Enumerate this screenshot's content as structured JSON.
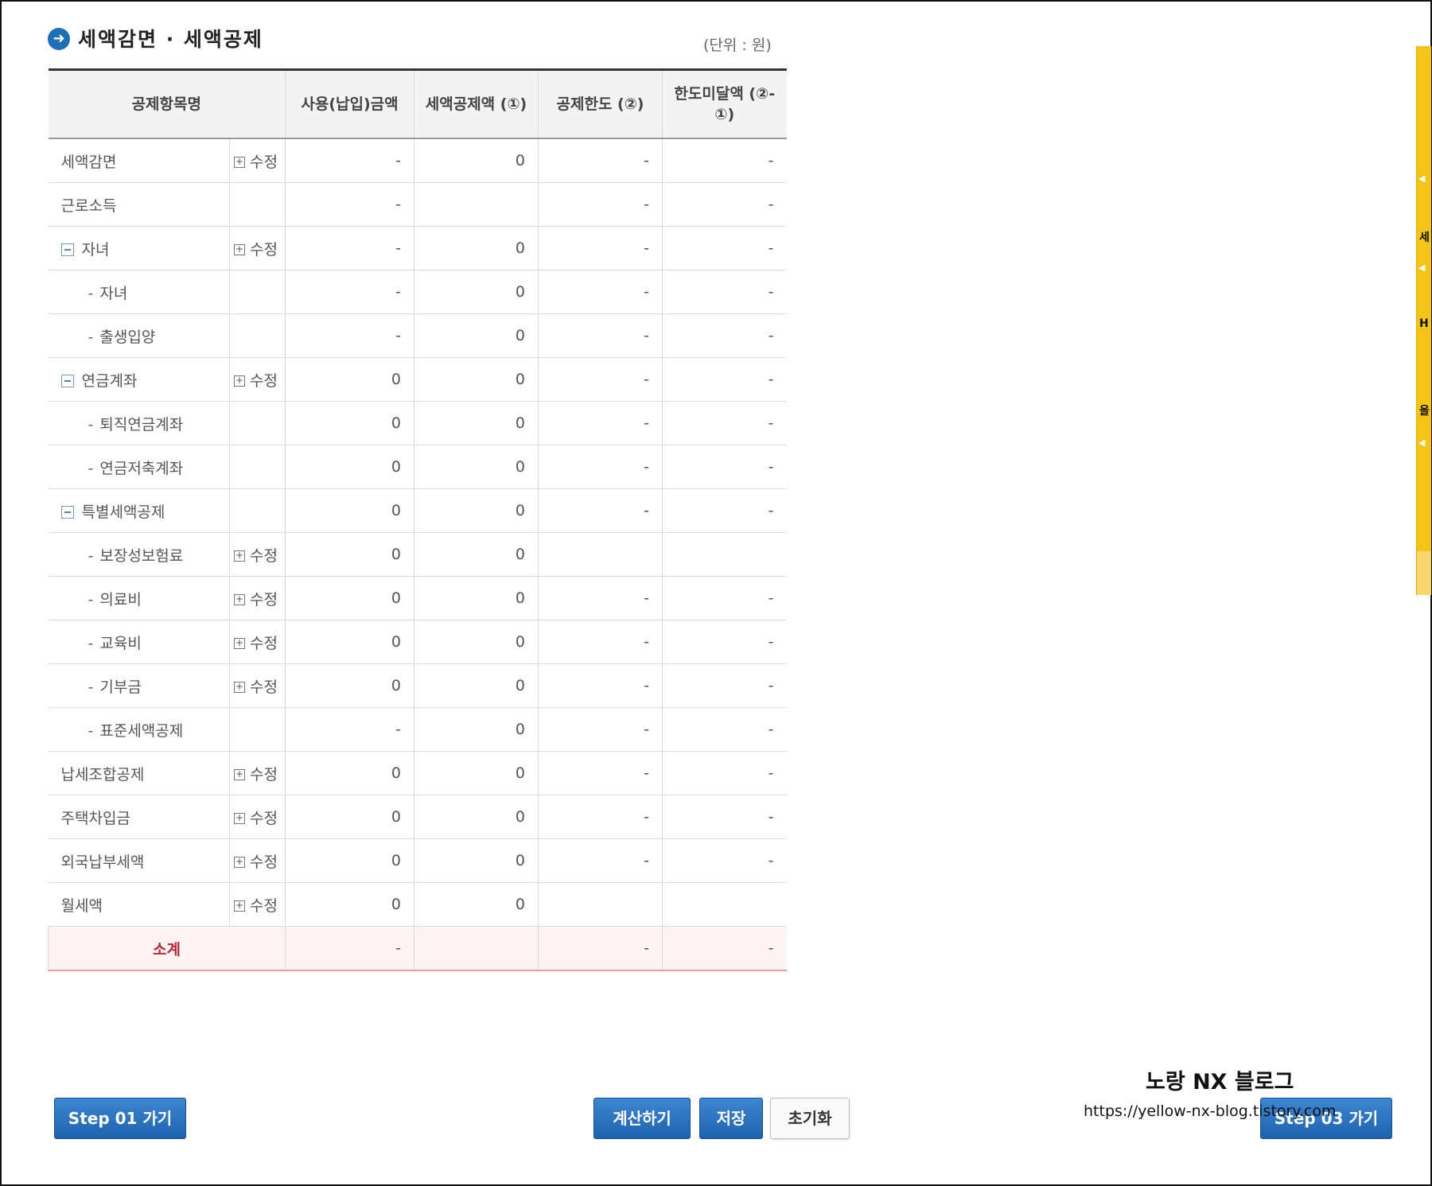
{
  "section": {
    "icon": "arrow-right-circle-icon",
    "title": "세액감면 · 세액공제",
    "unit": "(단위 : 원)"
  },
  "table": {
    "headers": {
      "item": "공제항목명",
      "used": "사용(납입)금액",
      "credit": "세액공제액 (①)",
      "limit": "공제한도 (②)",
      "remaining": "한도미달액 (②-①)"
    },
    "edit_label": "수정",
    "rows": [
      {
        "name": "세액감면",
        "level": 0,
        "collapsible": false,
        "edit": true,
        "used": "-",
        "credit": "0",
        "limit": "-",
        "remaining": "-"
      },
      {
        "name": "근로소득",
        "level": 0,
        "collapsible": false,
        "edit": false,
        "used": "-",
        "credit": "",
        "limit": "-",
        "remaining": "-"
      },
      {
        "name": "자녀",
        "level": 0,
        "collapsible": true,
        "edit": true,
        "used": "-",
        "credit": "0",
        "limit": "-",
        "remaining": "-"
      },
      {
        "name": "자녀",
        "level": 1,
        "collapsible": false,
        "edit": false,
        "used": "-",
        "credit": "0",
        "limit": "-",
        "remaining": "-"
      },
      {
        "name": "출생입양",
        "level": 1,
        "collapsible": false,
        "edit": false,
        "used": "-",
        "credit": "0",
        "limit": "-",
        "remaining": "-"
      },
      {
        "name": "연금계좌",
        "level": 0,
        "collapsible": true,
        "edit": true,
        "used": "0",
        "credit": "0",
        "limit": "-",
        "remaining": "-"
      },
      {
        "name": "퇴직연금계좌",
        "level": 1,
        "collapsible": false,
        "edit": false,
        "used": "0",
        "credit": "0",
        "limit": "-",
        "remaining": "-"
      },
      {
        "name": "연금저축계좌",
        "level": 1,
        "collapsible": false,
        "edit": false,
        "used": "0",
        "credit": "0",
        "limit": "-",
        "remaining": "-"
      },
      {
        "name": "특별세액공제",
        "level": 0,
        "collapsible": true,
        "edit": false,
        "used": "0",
        "credit": "0",
        "limit": "-",
        "remaining": "-"
      },
      {
        "name": "보장성보험료",
        "level": 1,
        "collapsible": false,
        "edit": true,
        "used": "0",
        "credit": "0",
        "limit": "",
        "remaining": ""
      },
      {
        "name": "의료비",
        "level": 1,
        "collapsible": false,
        "edit": true,
        "used": "0",
        "credit": "0",
        "limit": "-",
        "remaining": "-"
      },
      {
        "name": "교육비",
        "level": 1,
        "collapsible": false,
        "edit": true,
        "used": "0",
        "credit": "0",
        "limit": "-",
        "remaining": "-"
      },
      {
        "name": "기부금",
        "level": 1,
        "collapsible": false,
        "edit": true,
        "used": "0",
        "credit": "0",
        "limit": "-",
        "remaining": "-"
      },
      {
        "name": "표준세액공제",
        "level": 1,
        "collapsible": false,
        "edit": false,
        "used": "-",
        "credit": "0",
        "limit": "-",
        "remaining": "-"
      },
      {
        "name": "납세조합공제",
        "level": 0,
        "collapsible": false,
        "edit": true,
        "used": "0",
        "credit": "0",
        "limit": "-",
        "remaining": "-"
      },
      {
        "name": "주택차입금",
        "level": 0,
        "collapsible": false,
        "edit": true,
        "used": "0",
        "credit": "0",
        "limit": "-",
        "remaining": "-"
      },
      {
        "name": "외국납부세액",
        "level": 0,
        "collapsible": false,
        "edit": true,
        "used": "0",
        "credit": "0",
        "limit": "-",
        "remaining": "-"
      },
      {
        "name": "월세액",
        "level": 0,
        "collapsible": false,
        "edit": true,
        "used": "0",
        "credit": "0",
        "limit": "",
        "remaining": ""
      }
    ],
    "total": {
      "label": "소계",
      "used": "-",
      "credit": "",
      "limit": "-",
      "remaining": "-"
    }
  },
  "buttons": {
    "prev": "Step 01 가기",
    "calculate": "계산하기",
    "save": "저장",
    "reset": "초기화",
    "next": "Step 03 가기"
  },
  "watermark": {
    "title": "노랑 NX 블로그",
    "url": "https://yellow-nx-blog.tistory.com"
  },
  "colors": {
    "accent_blue": "#1f62ad",
    "side_strip": "#f5c418",
    "total_text": "#b02b3c",
    "total_bg": "#fdf2f4"
  }
}
